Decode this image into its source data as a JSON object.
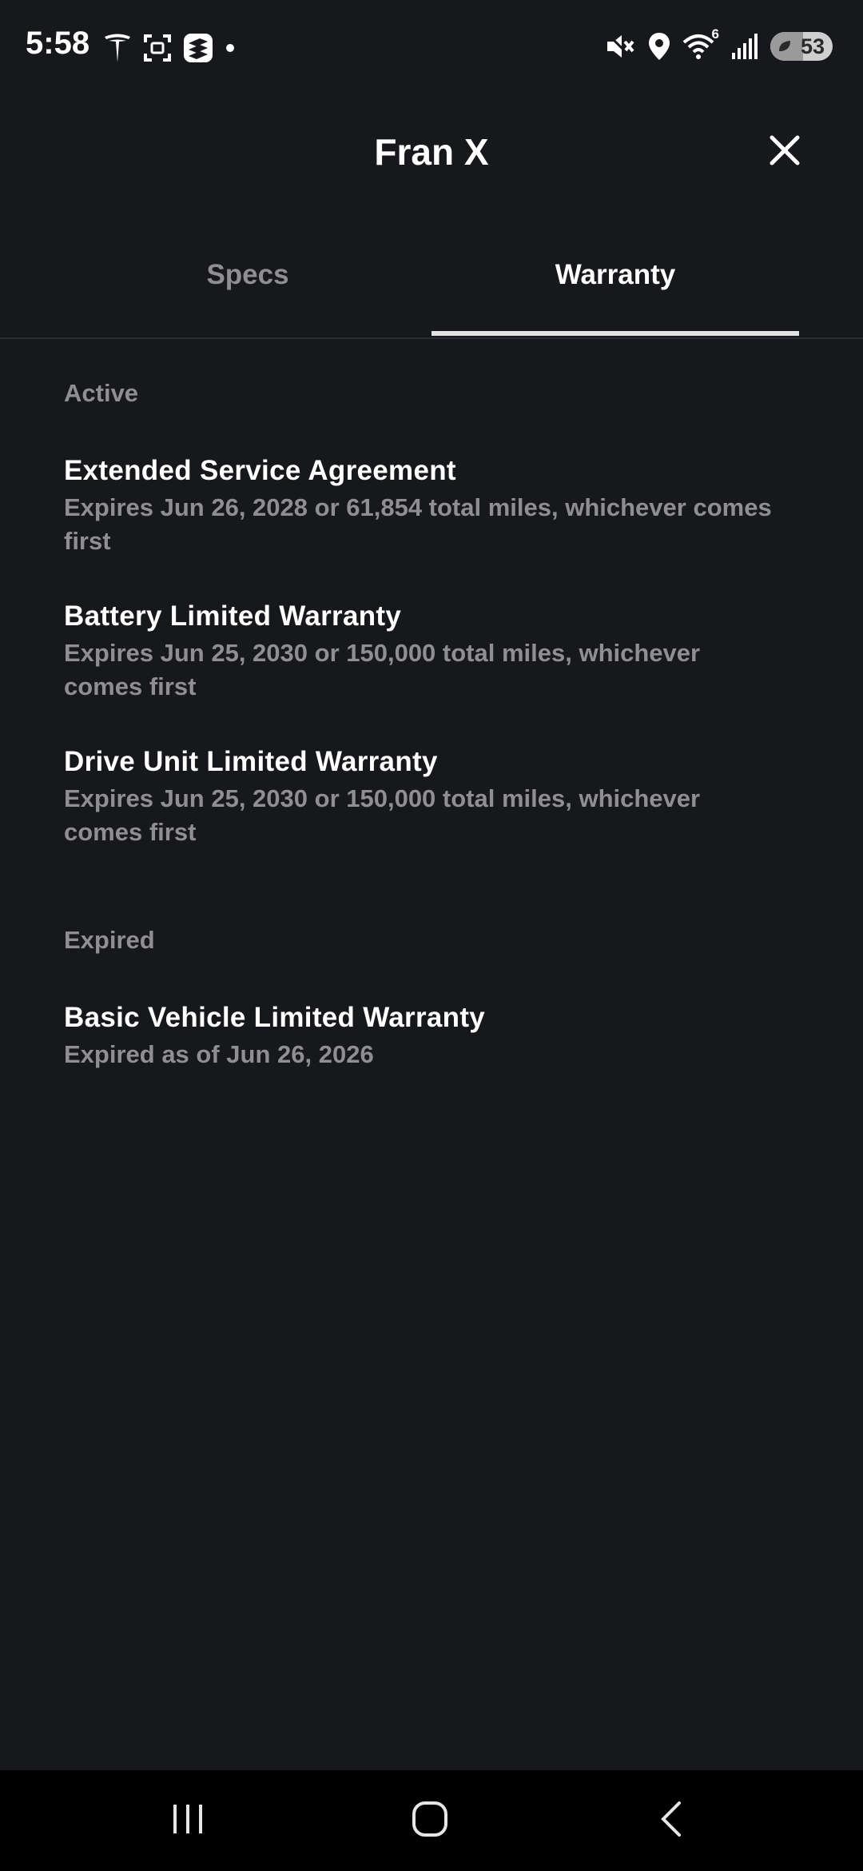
{
  "status_bar": {
    "time": "5:58",
    "left_icons": [
      "tesla-logo-icon",
      "screenshot-icon",
      "stack-app-icon",
      "notification-dot-icon"
    ],
    "right_icons": [
      "mute-icon",
      "location-icon",
      "wifi-icon",
      "signal-icon"
    ],
    "wifi_badge": "6",
    "battery_level": "53",
    "battery_fraction": 0.53
  },
  "header": {
    "title": "Fran X",
    "close_icon": "close-icon"
  },
  "tabs": [
    {
      "label": "Specs",
      "selected": false
    },
    {
      "label": "Warranty",
      "selected": true
    }
  ],
  "sections": {
    "active": {
      "label": "Active",
      "items": [
        {
          "title": "Extended Service Agreement",
          "subtitle": "Expires Jun 26, 2028 or 61,854 total miles, whichever comes first"
        },
        {
          "title": "Battery Limited Warranty",
          "subtitle": "Expires Jun 25, 2030 or 150,000 total miles, whichever comes first"
        },
        {
          "title": "Drive Unit Limited Warranty",
          "subtitle": "Expires Jun 25, 2030 or 150,000 total miles, whichever comes first"
        }
      ]
    },
    "expired": {
      "label": "Expired",
      "items": [
        {
          "title": "Basic Vehicle Limited Warranty",
          "subtitle": "Expired as of Jun 26, 2026"
        }
      ]
    }
  },
  "nav_bar": {
    "icons": [
      "recents-icon",
      "home-icon",
      "back-icon"
    ]
  },
  "colors": {
    "background": "#17181b",
    "text_primary": "#ffffff",
    "text_secondary": "#8e8e93",
    "tab_indicator": "#e2e2e2",
    "nav_background": "#000000"
  }
}
